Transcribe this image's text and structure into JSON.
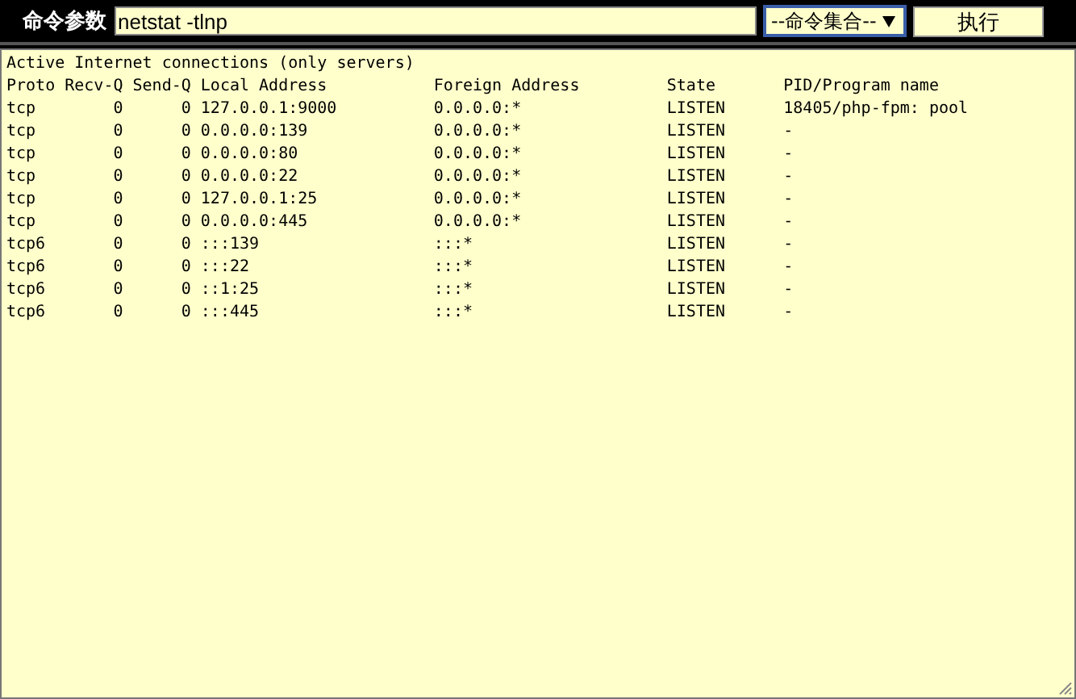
{
  "toolbar": {
    "label": "命令参数",
    "command": {
      "value": "netstat -tlnp"
    },
    "preset_select": {
      "value": "--命令集合--"
    },
    "run_button": "执行"
  },
  "output": {
    "lines": [
      "Active Internet connections (only servers)",
      "Proto Recv-Q Send-Q Local Address           Foreign Address         State       PID/Program name",
      "tcp        0      0 127.0.0.1:9000          0.0.0.0:*               LISTEN      18405/php-fpm: pool",
      "tcp        0      0 0.0.0.0:139             0.0.0.0:*               LISTEN      -",
      "tcp        0      0 0.0.0.0:80              0.0.0.0:*               LISTEN      -",
      "tcp        0      0 0.0.0.0:22              0.0.0.0:*               LISTEN      -",
      "tcp        0      0 127.0.0.1:25            0.0.0.0:*               LISTEN      -",
      "tcp        0      0 0.0.0.0:445             0.0.0.0:*               LISTEN      -",
      "tcp6       0      0 :::139                  :::*                    LISTEN      -",
      "tcp6       0      0 :::22                   :::*                    LISTEN      -",
      "tcp6       0      0 ::1:25                  :::*                    LISTEN      -",
      "tcp6       0      0 :::445                  :::*                    LISTEN      -"
    ]
  }
}
